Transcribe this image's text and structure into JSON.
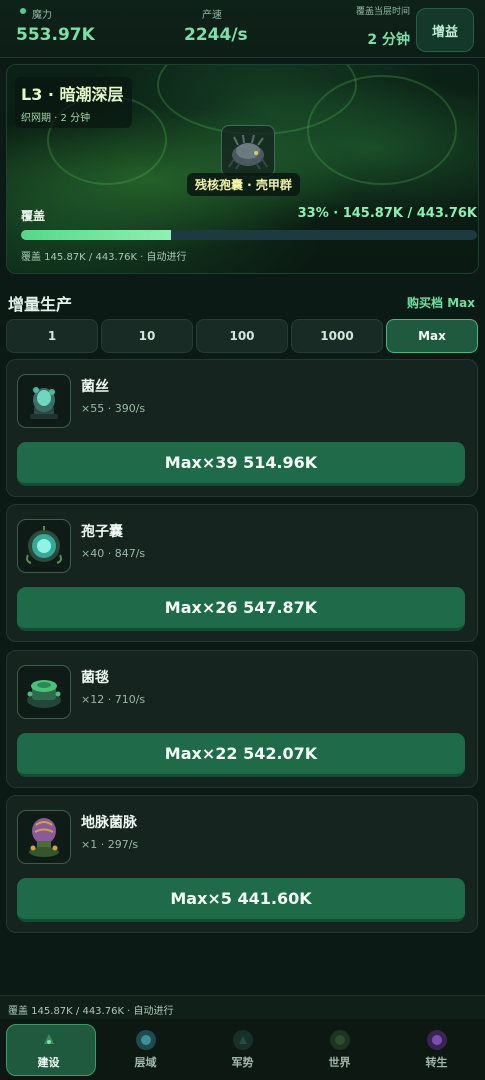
{
  "topbar": {
    "mana_label": "魔力",
    "mana_value": "553.97K",
    "rate_label": "产速",
    "rate_value": "2244/s",
    "time_label": "覆盖当层时间",
    "time_value": "2 分钟",
    "boost_label": "增益"
  },
  "layer": {
    "title": "L3 · 暗潮深层",
    "subtitle": "织网期 · 2 分钟",
    "boss_name": "残核孢囊 · 壳甲群",
    "coverage_label": "覆盖",
    "coverage_value": "33% · 145.87K / 443.76K",
    "coverage_fraction": 0.33,
    "footer": "覆盖 145.87K / 443.76K · 自动进行"
  },
  "section": {
    "title": "增量生产",
    "buy_mode": "购买档 Max"
  },
  "qty_tabs": [
    {
      "label": "1",
      "active": false
    },
    {
      "label": "10",
      "active": false
    },
    {
      "label": "100",
      "active": false
    },
    {
      "label": "1000",
      "active": false
    },
    {
      "label": "Max",
      "active": true
    }
  ],
  "items": [
    {
      "name": "菌丝",
      "meta": "×55 · 390/s",
      "buy_label": "Max×39 514.96K",
      "icon": "mycelium-icon"
    },
    {
      "name": "孢子囊",
      "meta": "×40 · 847/s",
      "buy_label": "Max×26 547.87K",
      "icon": "spore-sac-icon"
    },
    {
      "name": "菌毯",
      "meta": "×12 · 710/s",
      "buy_label": "Max×22 542.07K",
      "icon": "fungal-mat-icon"
    },
    {
      "name": "地脉菌脉",
      "meta": "×1 · 297/s",
      "buy_label": "Max×5 441.60K",
      "icon": "ley-vein-icon"
    }
  ],
  "status_strip": "覆盖 145.87K / 443.76K · 自动进行",
  "nav": [
    {
      "label": "建设",
      "active": true,
      "icon": "build-icon"
    },
    {
      "label": "层域",
      "active": false,
      "icon": "layer-icon"
    },
    {
      "label": "军势",
      "active": false,
      "icon": "army-icon"
    },
    {
      "label": "世界",
      "active": false,
      "icon": "world-icon"
    },
    {
      "label": "转生",
      "active": false,
      "icon": "rebirth-icon"
    }
  ],
  "colors": {
    "accent": "#7de0a8",
    "buy_button": "#1f6a48",
    "background": "#0c1a15"
  }
}
